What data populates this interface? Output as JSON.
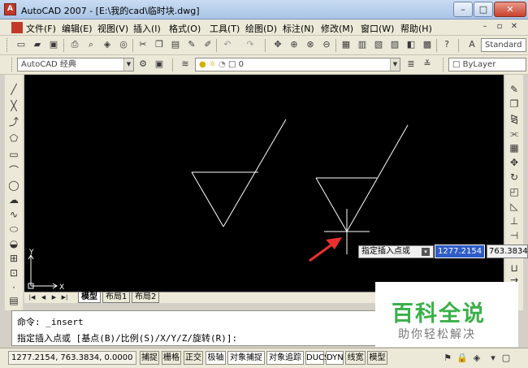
{
  "window": {
    "title": "AutoCAD 2007 - [E:\\我的cad\\临时块.dwg]",
    "app_icon": "A",
    "buttons": [
      "–",
      "□",
      "✕"
    ]
  },
  "menu": {
    "items": [
      "文件(F)",
      "编辑(E)",
      "视图(V)",
      "插入(I)",
      "格式(O)",
      "工具(T)",
      "绘图(D)",
      "标注(N)",
      "修改(M)",
      "窗口(W)",
      "帮助(H)"
    ],
    "doc_buttons": [
      "–",
      "▫",
      "✕"
    ]
  },
  "toolbar": {
    "text_style": "Standard",
    "workspace": "AutoCAD 经典",
    "layer": "0",
    "linetype": "ByLayer"
  },
  "tabs": [
    "模型",
    "布局1",
    "布局2"
  ],
  "ucs": {
    "y_label": "Y",
    "x_label": "X"
  },
  "dyn": {
    "prompt": "指定插入点或",
    "x_value": "1277.2154",
    "y_value": "763.3834"
  },
  "command": {
    "line1": "命令: _insert",
    "line2": "指定插入点或 [基点(B)/比例(S)/X/Y/Z/旋转(R)]:"
  },
  "status": {
    "coords": "1277.2154, 763.3834, 0.0000",
    "buttons": [
      "捕捉",
      "栅格",
      "正交",
      "极轴",
      "对象捕捉",
      "对象追踪",
      "DUCS",
      "DYN",
      "线宽",
      "模型"
    ]
  },
  "watermark": {
    "title": "百科全说",
    "subtitle": "助你轻松解决"
  },
  "colors": {
    "canvas": "#000000",
    "drawing": "#ffffff",
    "arrow": "#e8312c",
    "dyn_highlight": "#2f5cc7",
    "watermark_green": "#3ab04a"
  }
}
